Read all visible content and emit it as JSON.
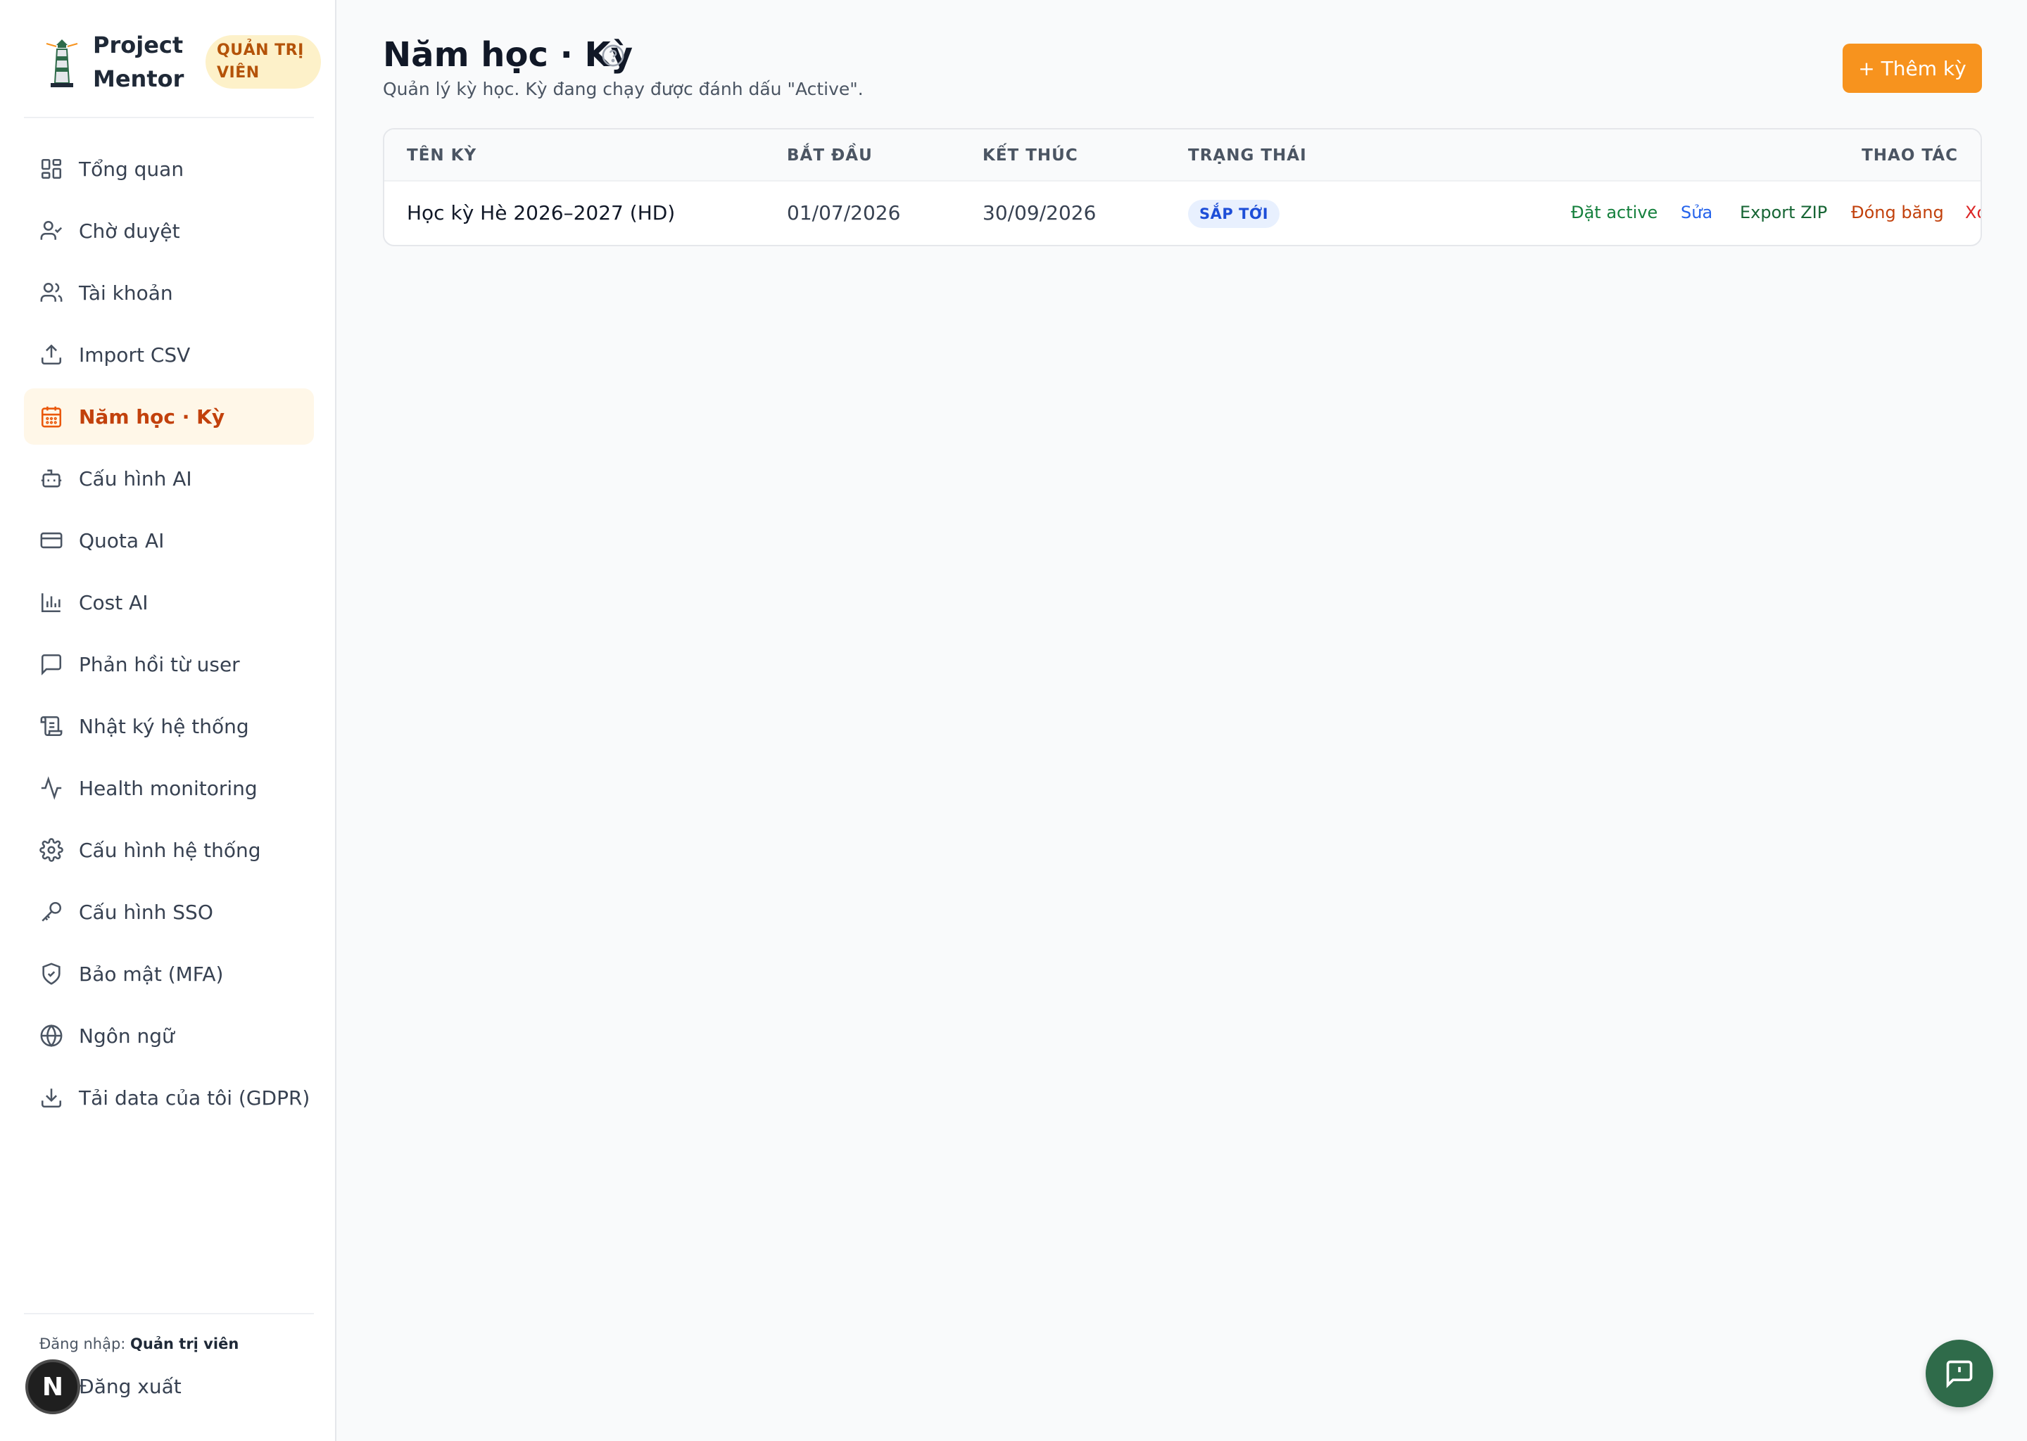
{
  "brand": {
    "name": "Project Mentor",
    "role_badge": "QUẢN TRỊ VIÊN"
  },
  "sidebar": {
    "items": [
      {
        "label": "Tổng quan",
        "icon": "layout-grid-icon"
      },
      {
        "label": "Chờ duyệt",
        "icon": "user-check-icon"
      },
      {
        "label": "Tài khoản",
        "icon": "users-icon"
      },
      {
        "label": "Import CSV",
        "icon": "upload-icon"
      },
      {
        "label": "Năm học · Kỳ",
        "icon": "calendar-icon",
        "active": true
      },
      {
        "label": "Cấu hình AI",
        "icon": "bot-icon"
      },
      {
        "label": "Quota AI",
        "icon": "credit-card-icon"
      },
      {
        "label": "Cost AI",
        "icon": "bar-chart-icon"
      },
      {
        "label": "Phản hồi từ user",
        "icon": "message-square-icon"
      },
      {
        "label": "Nhật ký hệ thống",
        "icon": "scroll-icon"
      },
      {
        "label": "Health monitoring",
        "icon": "activity-icon"
      },
      {
        "label": "Cấu hình hệ thống",
        "icon": "settings-icon"
      },
      {
        "label": "Cấu hình SSO",
        "icon": "key-icon"
      },
      {
        "label": "Bảo mật (MFA)",
        "icon": "shield-icon"
      },
      {
        "label": "Ngôn ngữ",
        "icon": "globe-icon"
      },
      {
        "label": "Tải data của tôi (GDPR)",
        "icon": "download-icon"
      }
    ],
    "footer": {
      "login_prefix": "Đăng nhập:",
      "login_user": "Quản trị viên",
      "logout_label": "Đăng xuất",
      "next_badge": "N"
    }
  },
  "page": {
    "title": "Năm học · Kỳ",
    "subtitle": "Quản lý kỳ học. Kỳ đang chạy được đánh dấu \"Active\".",
    "add_button": "+ Thêm kỳ"
  },
  "table": {
    "headers": {
      "name": "TÊN KỲ",
      "start": "BẮT ĐẦU",
      "end": "KẾT THÚC",
      "status": "TRẠNG THÁI",
      "actions": "THAO TÁC"
    },
    "rows": [
      {
        "name": "Học kỳ Hè 2026–2027 (HD)",
        "start": "01/07/2026",
        "end": "30/09/2026",
        "status": "SẮP TỚI",
        "actions": {
          "activate": "Đặt active",
          "edit": "Sửa",
          "export": "Export ZIP",
          "freeze": "Đóng băng",
          "delete": "Xoá"
        }
      }
    ]
  },
  "colors": {
    "accent": "#f7931e",
    "active_nav_text": "#c2410c",
    "activate_action": "#15803d",
    "edit_action": "#2563eb",
    "export_action": "#166534",
    "freeze_action": "#c2410c",
    "delete_action": "#dc2626",
    "fab": "#2f6b4a"
  }
}
